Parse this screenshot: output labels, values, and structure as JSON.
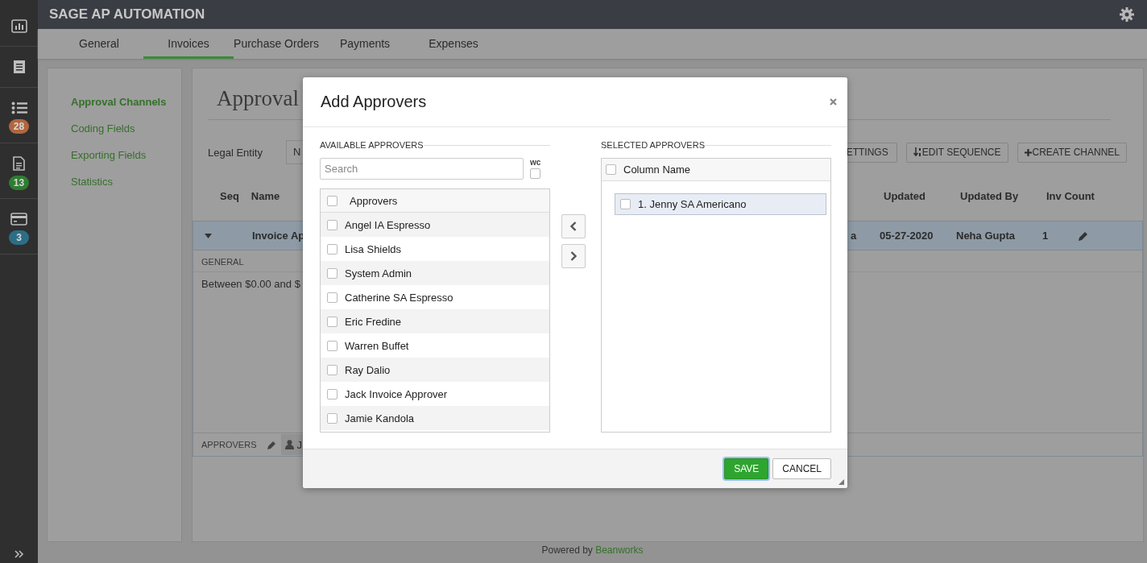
{
  "sidebar": {
    "items": [
      {
        "kind": "chart"
      },
      {
        "kind": "receipt"
      },
      {
        "kind": "list",
        "badge": "28",
        "color": "#b0663f"
      },
      {
        "kind": "file",
        "badge": "13",
        "color": "#2f7d32"
      },
      {
        "kind": "card",
        "badge": "3",
        "color": "#2c6e86"
      }
    ]
  },
  "app_title": "SAGE AP AUTOMATION",
  "tabs": [
    {
      "label": "General",
      "selected": false
    },
    {
      "label": "Invoices",
      "selected": true
    },
    {
      "label": "Purchase Orders",
      "selected": false
    },
    {
      "label": "Payments",
      "selected": false
    },
    {
      "label": "Expenses",
      "selected": false
    }
  ],
  "nav": {
    "items": [
      {
        "label": "Approval Channels",
        "selected": true
      },
      {
        "label": "Coding Fields",
        "selected": false
      },
      {
        "label": "Exporting Fields",
        "selected": false
      },
      {
        "label": "Statistics",
        "selected": false
      }
    ]
  },
  "page": {
    "title": "Approval",
    "legal_entity": {
      "label": "Legal Entity",
      "value": "N"
    },
    "buttons": [
      {
        "label": "ETTINGS",
        "kind": "plain"
      },
      {
        "label": "EDIT SEQUENCE",
        "kind": "sort"
      },
      {
        "label": "CREATE CHANNEL",
        "kind": "create"
      }
    ],
    "table": {
      "columns_left": [
        "Seq",
        "Name"
      ],
      "columns_right": [
        "Updated",
        "Updated By",
        "Inv Count"
      ],
      "rows": [
        {
          "expanded": true,
          "name": "Invoice Ap",
          "column_3": "a",
          "updated": "05-27-2020",
          "updated_by": "Neha Gupta",
          "inv_count": "1",
          "details": {
            "section": "GENERAL",
            "condition": "Between $0.00 and $",
            "approvers_label": "APPROVERS",
            "approver": "J"
          }
        }
      ]
    }
  },
  "footer": {
    "text": "Powered by",
    "link": "Beanworks"
  },
  "modal": {
    "title": "Add Approvers",
    "available": {
      "legend": "AVAILABLE APPROVERS",
      "search_placeholder": "Search",
      "wc_label": "wc",
      "wc_checked": false,
      "header": "Approvers",
      "header_checked": false,
      "items": [
        {
          "name": "Angel IA Espresso",
          "checked": false
        },
        {
          "name": "Lisa Shields",
          "checked": false
        },
        {
          "name": "System Admin",
          "checked": false
        },
        {
          "name": "Catherine SA Espresso",
          "checked": false
        },
        {
          "name": "Eric Fredine",
          "checked": false
        },
        {
          "name": "Warren Buffet",
          "checked": false
        },
        {
          "name": "Ray Dalio",
          "checked": false
        },
        {
          "name": "Jack Invoice Approver",
          "checked": false
        },
        {
          "name": "Jamie Kandola",
          "checked": false
        }
      ]
    },
    "selected": {
      "legend": "SELECTED APPROVERS",
      "header": "Column Name",
      "header_checked": false,
      "items": [
        {
          "name": "1. Jenny SA Americano",
          "checked": false
        }
      ]
    },
    "buttons": [
      {
        "label": "SAVE",
        "kind": "primary",
        "focused": true
      },
      {
        "label": "CANCEL",
        "kind": "default",
        "focused": false
      }
    ]
  }
}
